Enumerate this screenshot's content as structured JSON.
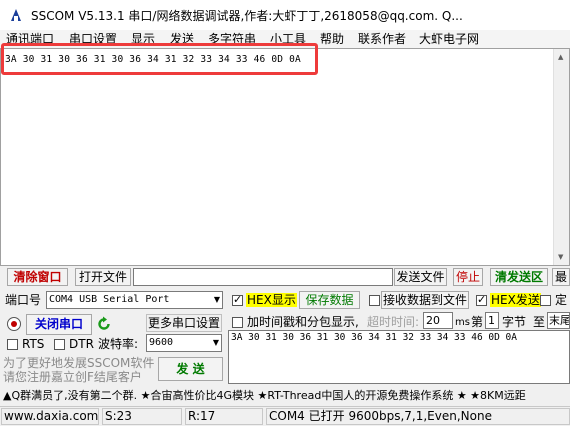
{
  "window": {
    "title": "SSCOM V5.13.1 串口/网络数据调试器,作者:大虾丁丁,2618058@qq.com. Q..."
  },
  "menu": {
    "items": [
      "通讯端口",
      "串口设置",
      "显示",
      "发送",
      "多字符串",
      "小工具",
      "帮助",
      "联系作者",
      "大虾电子网"
    ]
  },
  "receive": {
    "text": "3A 30 31 30 36 31 30 36 34 31 32 33 34 33 46 0D 0A"
  },
  "toolbar": {
    "clear_window": "清除窗口",
    "open_file": "打开文件",
    "send_file": "发送文件",
    "stop": "停止",
    "clear_send": "清发送区",
    "last": "最"
  },
  "port": {
    "label": "端口号",
    "value": "COM4 USB Serial Port",
    "close_button": "关闭串口",
    "more_settings": "更多串口设置",
    "rts": "RTS",
    "dtr": "DTR",
    "baud_label": "波特率:",
    "baud_value": "9600"
  },
  "options": {
    "hex_display": "HEX显示",
    "save_data": "保存数据",
    "recv_to_file": "接收数据到文件",
    "hex_send": "HEX发送",
    "timed": "定",
    "add_timestamp": "加时间戳和分包显示,",
    "timeout_label": "超时时间:",
    "timeout_value": "20",
    "ms": "ms",
    "nth": "第",
    "nth_value": "1",
    "byte": "字节",
    "to": "至",
    "end": "末尾"
  },
  "send": {
    "text": "3A 30 31 30 36 31 30 36 34 31 32 33 34 33 46 0D 0A",
    "button": "发 送"
  },
  "promo": {
    "line1": "为了更好地发展SSCOM软件",
    "line2": "请您注册嘉立创F结尾客户"
  },
  "ticker": {
    "text": "▲Q群满员了,没有第二个群. ★合宙高性价比4G模块 ★RT-Thread中国人的开源免费操作系统 ★ ★8KM远距"
  },
  "status": {
    "site": "www.daxia.com",
    "sent": "S:23",
    "received": "R:17",
    "port_info": "COM4 已打开  9600bps,7,1,Even,None"
  },
  "colors": {
    "highlight": "#ee3b3b",
    "hex_bg": "#ffff00",
    "close_button_text": "#0000cc",
    "refresh_icon": "#1a9a1a"
  }
}
